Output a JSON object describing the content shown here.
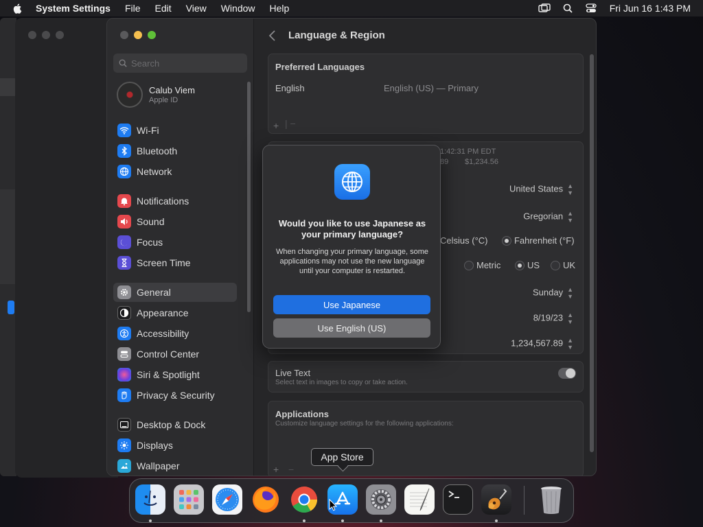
{
  "menubar": {
    "app_name": "System Settings",
    "menus": [
      "File",
      "Edit",
      "View",
      "Window",
      "Help"
    ],
    "clock": "Fri Jun 16  1:43 PM"
  },
  "sidebar": {
    "search_placeholder": "Search",
    "account": {
      "name": "Calub Viem",
      "subtitle": "Apple ID"
    },
    "items": [
      {
        "label": "Wi-Fi",
        "icon": "wifi-icon",
        "color": "#1e7cf2"
      },
      {
        "label": "Bluetooth",
        "icon": "bluetooth-icon",
        "color": "#1e7cf2"
      },
      {
        "label": "Network",
        "icon": "network-icon",
        "color": "#1e7cf2"
      },
      {
        "label": "Notifications",
        "icon": "bell-icon",
        "color": "#e5484d"
      },
      {
        "label": "Sound",
        "icon": "speaker-icon",
        "color": "#e5484d"
      },
      {
        "label": "Focus",
        "icon": "moon-icon",
        "color": "#5b4fd6"
      },
      {
        "label": "Screen Time",
        "icon": "hourglass-icon",
        "color": "#5b4fd6"
      },
      {
        "label": "General",
        "icon": "gear-icon",
        "color": "#8e8e93"
      },
      {
        "label": "Appearance",
        "icon": "appearance-icon",
        "color": "#1c1c1e"
      },
      {
        "label": "Accessibility",
        "icon": "accessibility-icon",
        "color": "#1e7cf2"
      },
      {
        "label": "Control Center",
        "icon": "control-center-icon",
        "color": "#8e8e93"
      },
      {
        "label": "Siri & Spotlight",
        "icon": "siri-icon",
        "color": "#9a4dd8"
      },
      {
        "label": "Privacy & Security",
        "icon": "hand-icon",
        "color": "#1e7cf2"
      },
      {
        "label": "Desktop & Dock",
        "icon": "dock-icon",
        "color": "#1c1c1e"
      },
      {
        "label": "Displays",
        "icon": "sun-icon",
        "color": "#1e7cf2"
      },
      {
        "label": "Wallpaper",
        "icon": "wallpaper-icon",
        "color": "#2aa8d8"
      }
    ],
    "selected": "General"
  },
  "main": {
    "title": "Language & Region",
    "preferred": {
      "heading": "Preferred Languages",
      "language": "English",
      "detail": "English (US) — Primary"
    },
    "format_preview": {
      "line1": "1:42:31 PM EDT",
      "line2a": "89",
      "line2b": "$1,234.56"
    },
    "region": "United States",
    "calendar": "Gregorian",
    "temperature": {
      "celsius": "Celsius (°C)",
      "fahrenheit": "Fahrenheit (°F)",
      "selected": "fahrenheit"
    },
    "measurement": {
      "metric": "Metric",
      "us": "US",
      "uk": "UK",
      "selected": "us"
    },
    "first_day": "Sunday",
    "date_format": "8/19/23",
    "number_format": "1,234,567.89",
    "live_text": {
      "title": "Live Text",
      "description": "Select text in images to copy or take action.",
      "on": true
    },
    "applications": {
      "title": "Applications",
      "description": "Customize language settings for the following applications:"
    }
  },
  "dialog": {
    "title": "Would you like to use Japanese as your primary language?",
    "body": "When changing your primary language, some applications may not use the new language until your computer is restarted.",
    "primary_button": "Use Japanese",
    "secondary_button": "Use English (US)"
  },
  "tooltip": "App Store",
  "dock": {
    "apps": [
      "Finder",
      "Launchpad",
      "Safari",
      "Firefox",
      "Chrome",
      "App Store",
      "System Settings",
      "TextEdit",
      "Terminal",
      "GarageBand",
      "Trash"
    ]
  }
}
